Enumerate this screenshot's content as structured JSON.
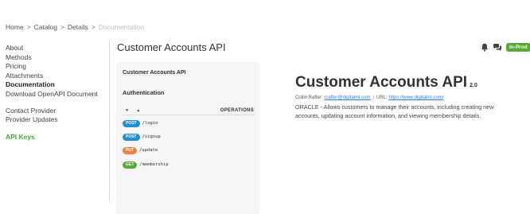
{
  "breadcrumb": {
    "items": [
      "Home",
      "Catalog",
      "Details"
    ],
    "current": "Documentation",
    "separator": ">"
  },
  "sidebar": {
    "items": [
      {
        "label": "About"
      },
      {
        "label": "Methods"
      },
      {
        "label": "Pricing"
      },
      {
        "label": "Attachments"
      },
      {
        "label": "Documentation",
        "active": true
      },
      {
        "label": "Download OpenAPI Document"
      },
      {
        "label": "Contact Provider"
      },
      {
        "label": "Provider Updates"
      },
      {
        "label": "API Keys"
      }
    ]
  },
  "header": {
    "title": "Customer Accounts API",
    "icons": [
      "bell-icon",
      "feedback-icon"
    ],
    "status_badge": "In-Prod"
  },
  "panel": {
    "title": "Customer Accounts API",
    "section": "Authentication",
    "operations_label": "OPERATIONS",
    "sort_arrows": "▼ ▲",
    "operations": [
      {
        "method": "POST",
        "path": "/login"
      },
      {
        "method": "POST",
        "path": "/signup"
      },
      {
        "method": "PUT",
        "path": "/update"
      },
      {
        "method": "GET",
        "path": "/membership"
      }
    ]
  },
  "detail": {
    "title": "Customer Accounts API",
    "version": "2.0",
    "author": "Collin Rafter:",
    "email": "crafter@digitalml.com",
    "url_label": "URL:",
    "url": "https://www.digitalml.com/",
    "description": "ORACLE - Allows customers to manage their accounts, including creating new accounts, updating account information, and viewing membership details."
  },
  "colors": {
    "accent_green": "#5aa837",
    "post": "#1e8fd6",
    "put": "#f47c3c",
    "get": "#5aa837",
    "link": "#2c7be5"
  }
}
